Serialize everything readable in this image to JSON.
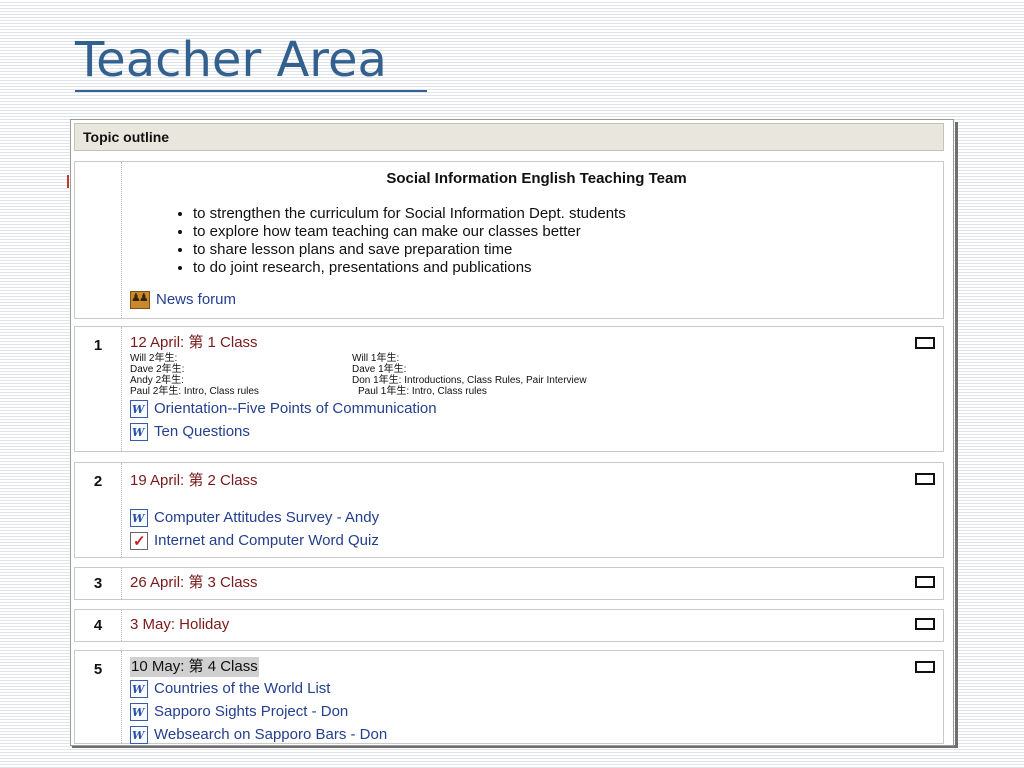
{
  "slide": {
    "title": "Teacher Area"
  },
  "outline": {
    "header": "Topic outline",
    "intro": {
      "title": "Social Information English Teaching Team",
      "goals": [
        "to strengthen the curriculum for Social Information Dept. students",
        "to explore how team teaching can make our classes better",
        "to share lesson plans and save preparation time",
        "to do joint research, presentations and publications"
      ],
      "forum": {
        "label": "News forum",
        "icon": "forum-icon"
      }
    },
    "sections": [
      {
        "num": "1",
        "date": "12 April:  第 1 Class",
        "notes_left": [
          "Will 2年生:",
          "Dave 2年生:",
          "Andy 2年生:",
          "Paul 2年生: Intro, Class rules"
        ],
        "notes_right": [
          "Will 1年生:",
          "Dave 1年生:",
          "Don 1年生:  Introductions, Class Rules, Pair Interview",
          "Paul 1年生: Intro, Class rules"
        ],
        "resources": [
          {
            "label": "Orientation--Five Points of Communication",
            "icon": "word-doc-icon"
          },
          {
            "label": "Ten Questions",
            "icon": "word-doc-icon"
          }
        ]
      },
      {
        "num": "2",
        "date": "19 April:  第 2 Class",
        "resources": [
          {
            "label": "Computer Attitudes Survey - Andy",
            "icon": "word-doc-icon"
          },
          {
            "label": "Internet and Computer Word Quiz",
            "icon": "quiz-icon"
          }
        ]
      },
      {
        "num": "3",
        "date": "26 April: 第 3 Class",
        "resources": []
      },
      {
        "num": "4",
        "date": "3 May:  Holiday",
        "resources": []
      },
      {
        "num": "5",
        "date": "10 May: 第 4  Class",
        "resources": [
          {
            "label": "Countries of the World List",
            "icon": "word-doc-icon"
          },
          {
            "label": "Sapporo Sights Project - Don",
            "icon": "word-doc-icon"
          },
          {
            "label": "Websearch on Sapporo Bars - Don",
            "icon": "word-doc-icon"
          }
        ]
      }
    ]
  },
  "colors": {
    "title": "#33618f",
    "link": "#24408e",
    "date": "#7a1a1a",
    "header_bg": "#e9e7dd"
  }
}
